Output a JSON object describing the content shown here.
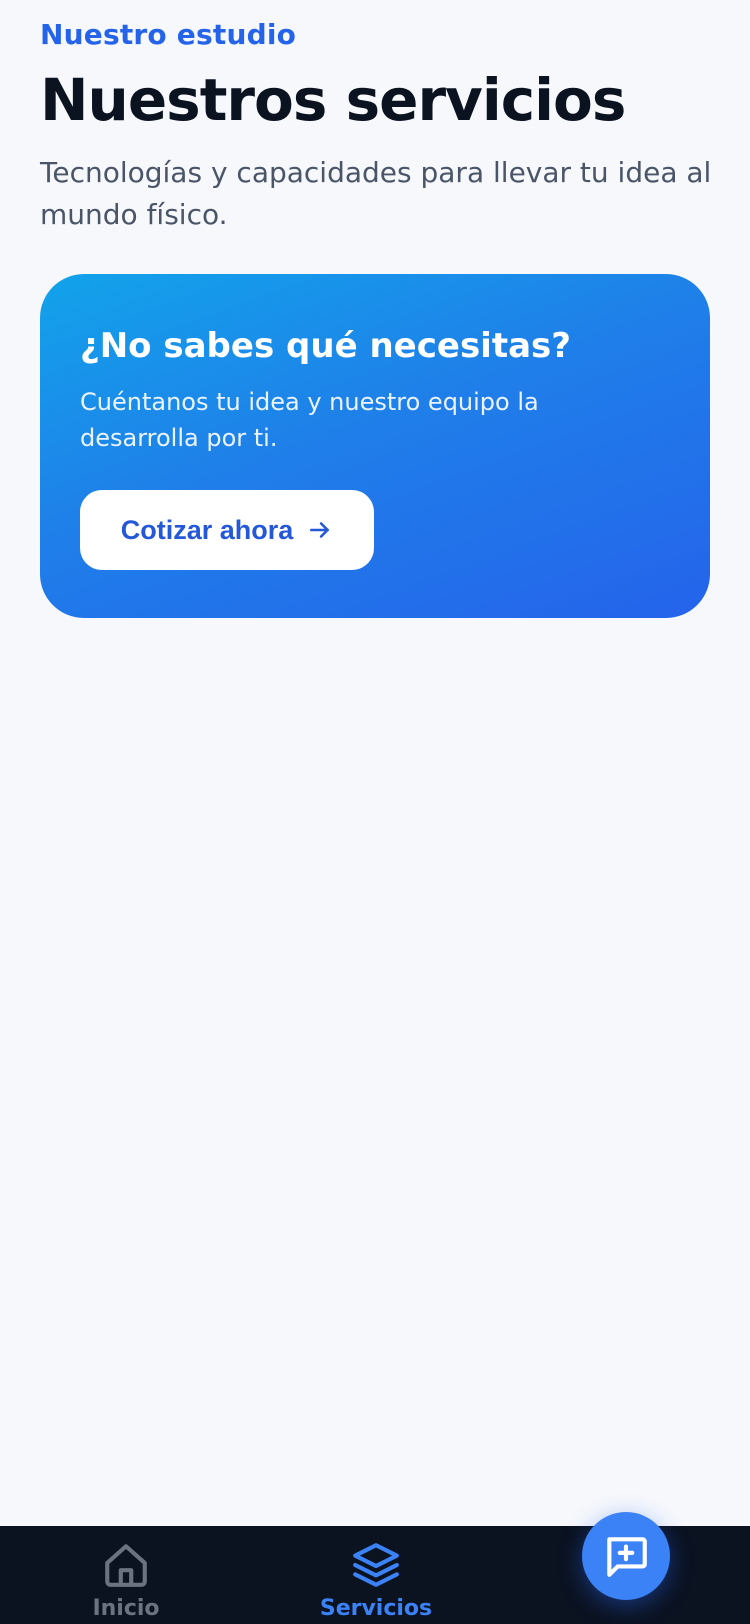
{
  "header": {
    "eyebrow": "Nuestro estudio",
    "title": "Nuestros servicios",
    "subtitle": "Tecnologías y capacidades para llevar tu idea al mundo físico."
  },
  "cta": {
    "title": "¿No sabes qué necesitas?",
    "text": "Cuéntanos tu idea y nuestro equipo la desarrolla por ti.",
    "button_label": "Cotizar ahora",
    "button_icon": "arrow-right-icon"
  },
  "bottom_nav": {
    "items": [
      {
        "label": "Inicio",
        "icon": "home-icon",
        "active": false
      },
      {
        "label": "Servicios",
        "icon": "layers-icon",
        "active": true
      }
    ]
  },
  "fab": {
    "icon": "message-plus-icon"
  },
  "colors": {
    "accent": "#2563eb",
    "background": "#f6f8fc",
    "nav_background": "#0b1220",
    "title": "#0b1220",
    "subtitle": "#4b5568",
    "nav_inactive": "#6b7280",
    "nav_active": "#3b82f6",
    "fab": "#3b82f6",
    "card_gradient_start": "#12a3ea",
    "card_gradient_end": "#2563eb"
  }
}
